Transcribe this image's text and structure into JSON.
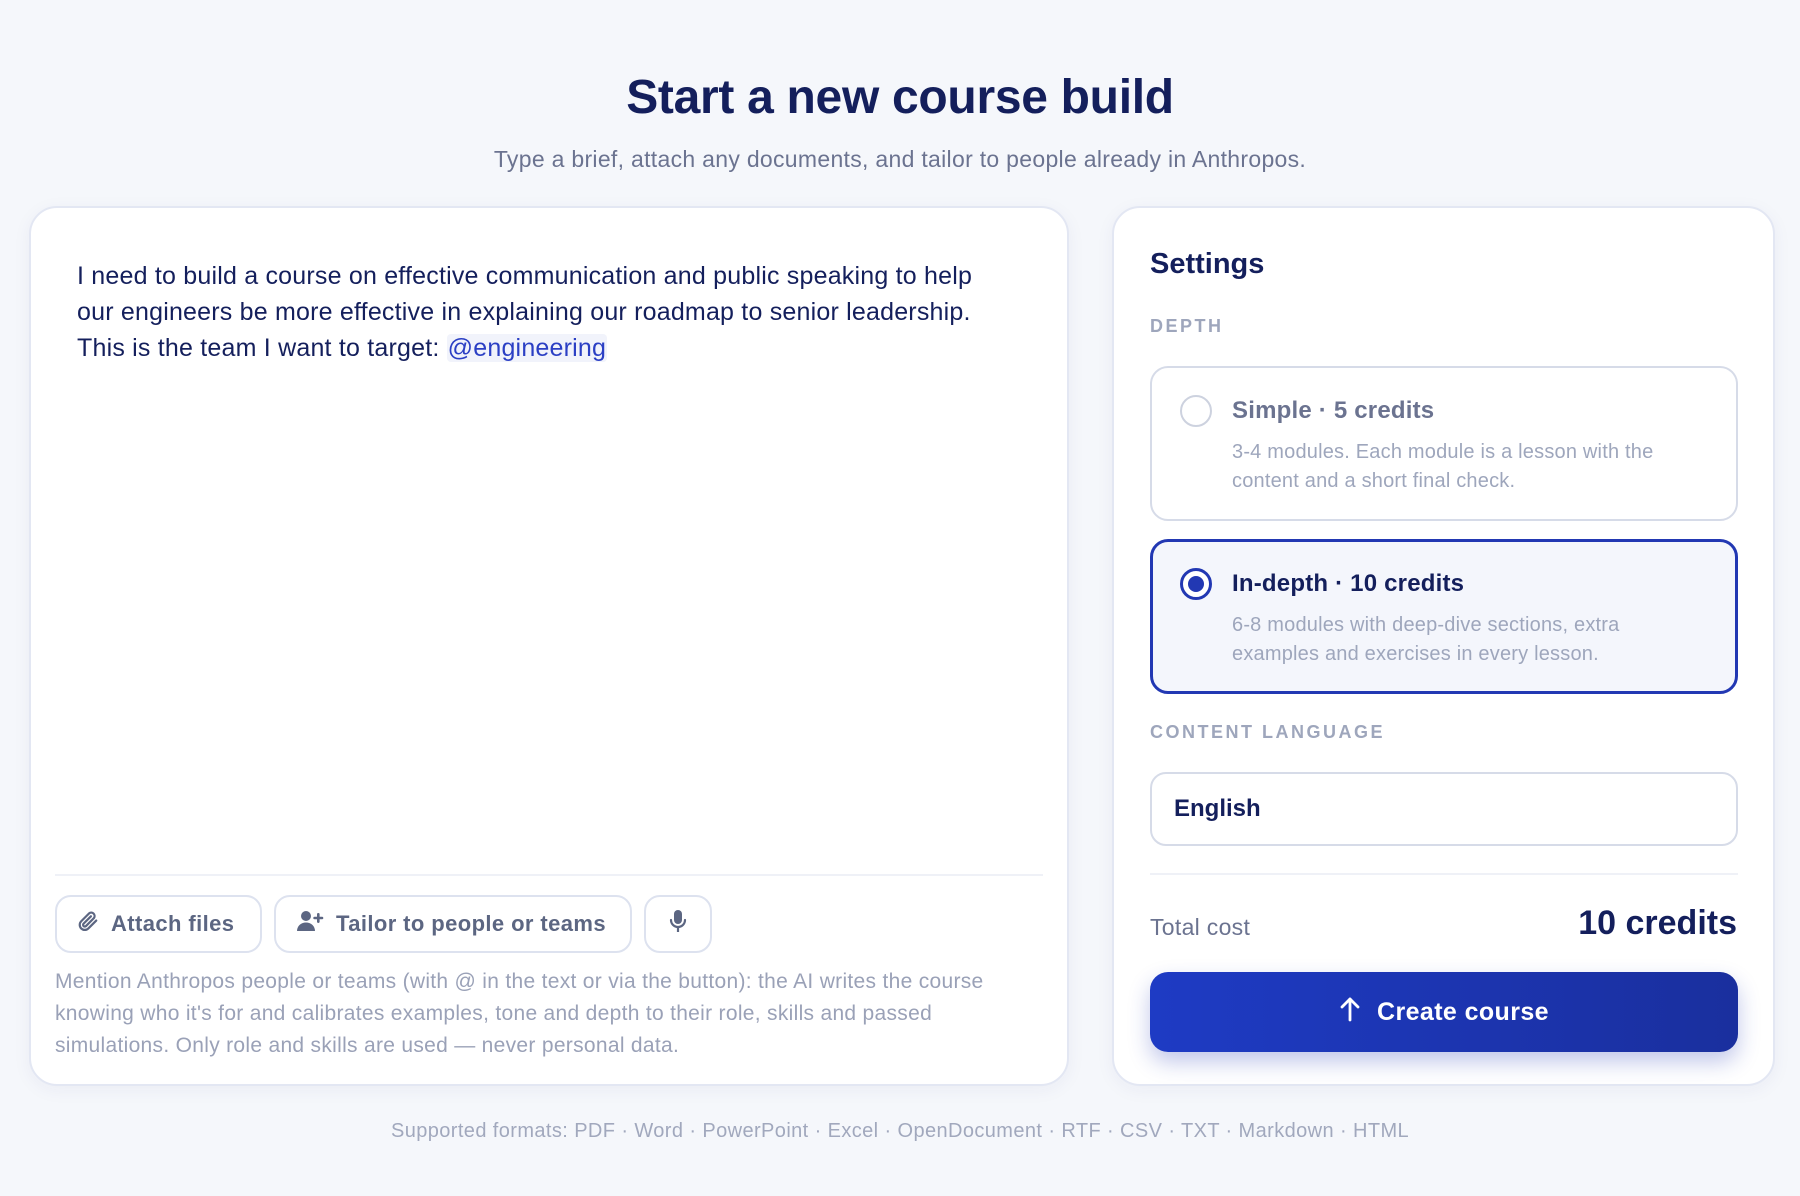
{
  "header": {
    "title": "Start a new course build",
    "subtitle": "Type a brief, attach any documents, and tailor to people already in Anthropos."
  },
  "brief": {
    "text": "I need to build a course on effective communication and public speaking to help our engineers be more effective in explaining our roadmap to senior leadership. This is the team I want to target: ",
    "mention": "@engineering",
    "toolbar": {
      "attach_label": "Attach files",
      "attach_icon": "paperclip-icon",
      "tailor_label": "Tailor to people or teams",
      "tailor_icon": "user-plus-icon",
      "mic_icon": "microphone-icon"
    },
    "helper": "Mention Anthropos people or teams (with @ in the text or via the button): the AI writes the course knowing who it's for and calibrates examples, tone and depth to their role, skills and passed simulations. Only role and skills are used — never personal data."
  },
  "settings": {
    "title": "Settings",
    "depth_label": "DEPTH",
    "options": [
      {
        "title": "Simple · 5 credits",
        "description": "3-4 modules. Each module is a lesson with the content and a short final check.",
        "selected": false
      },
      {
        "title": "In-depth · 10 credits",
        "description": "6-8 modules with deep-dive sections, extra examples and exercises in every lesson.",
        "selected": true
      }
    ],
    "language_label": "CONTENT LANGUAGE",
    "language_value": "English",
    "total_label": "Total cost",
    "total_value": "10 credits",
    "create_label": "Create course",
    "create_icon": "arrow-up-icon"
  },
  "footer": {
    "formats": "Supported formats: PDF · Word · PowerPoint · Excel · OpenDocument · RTF · CSV · TXT · Markdown · HTML"
  },
  "colors": {
    "primary": "#2238b3",
    "background": "#f5f7fb",
    "text": "#141f5c",
    "muted": "#6b7390"
  }
}
